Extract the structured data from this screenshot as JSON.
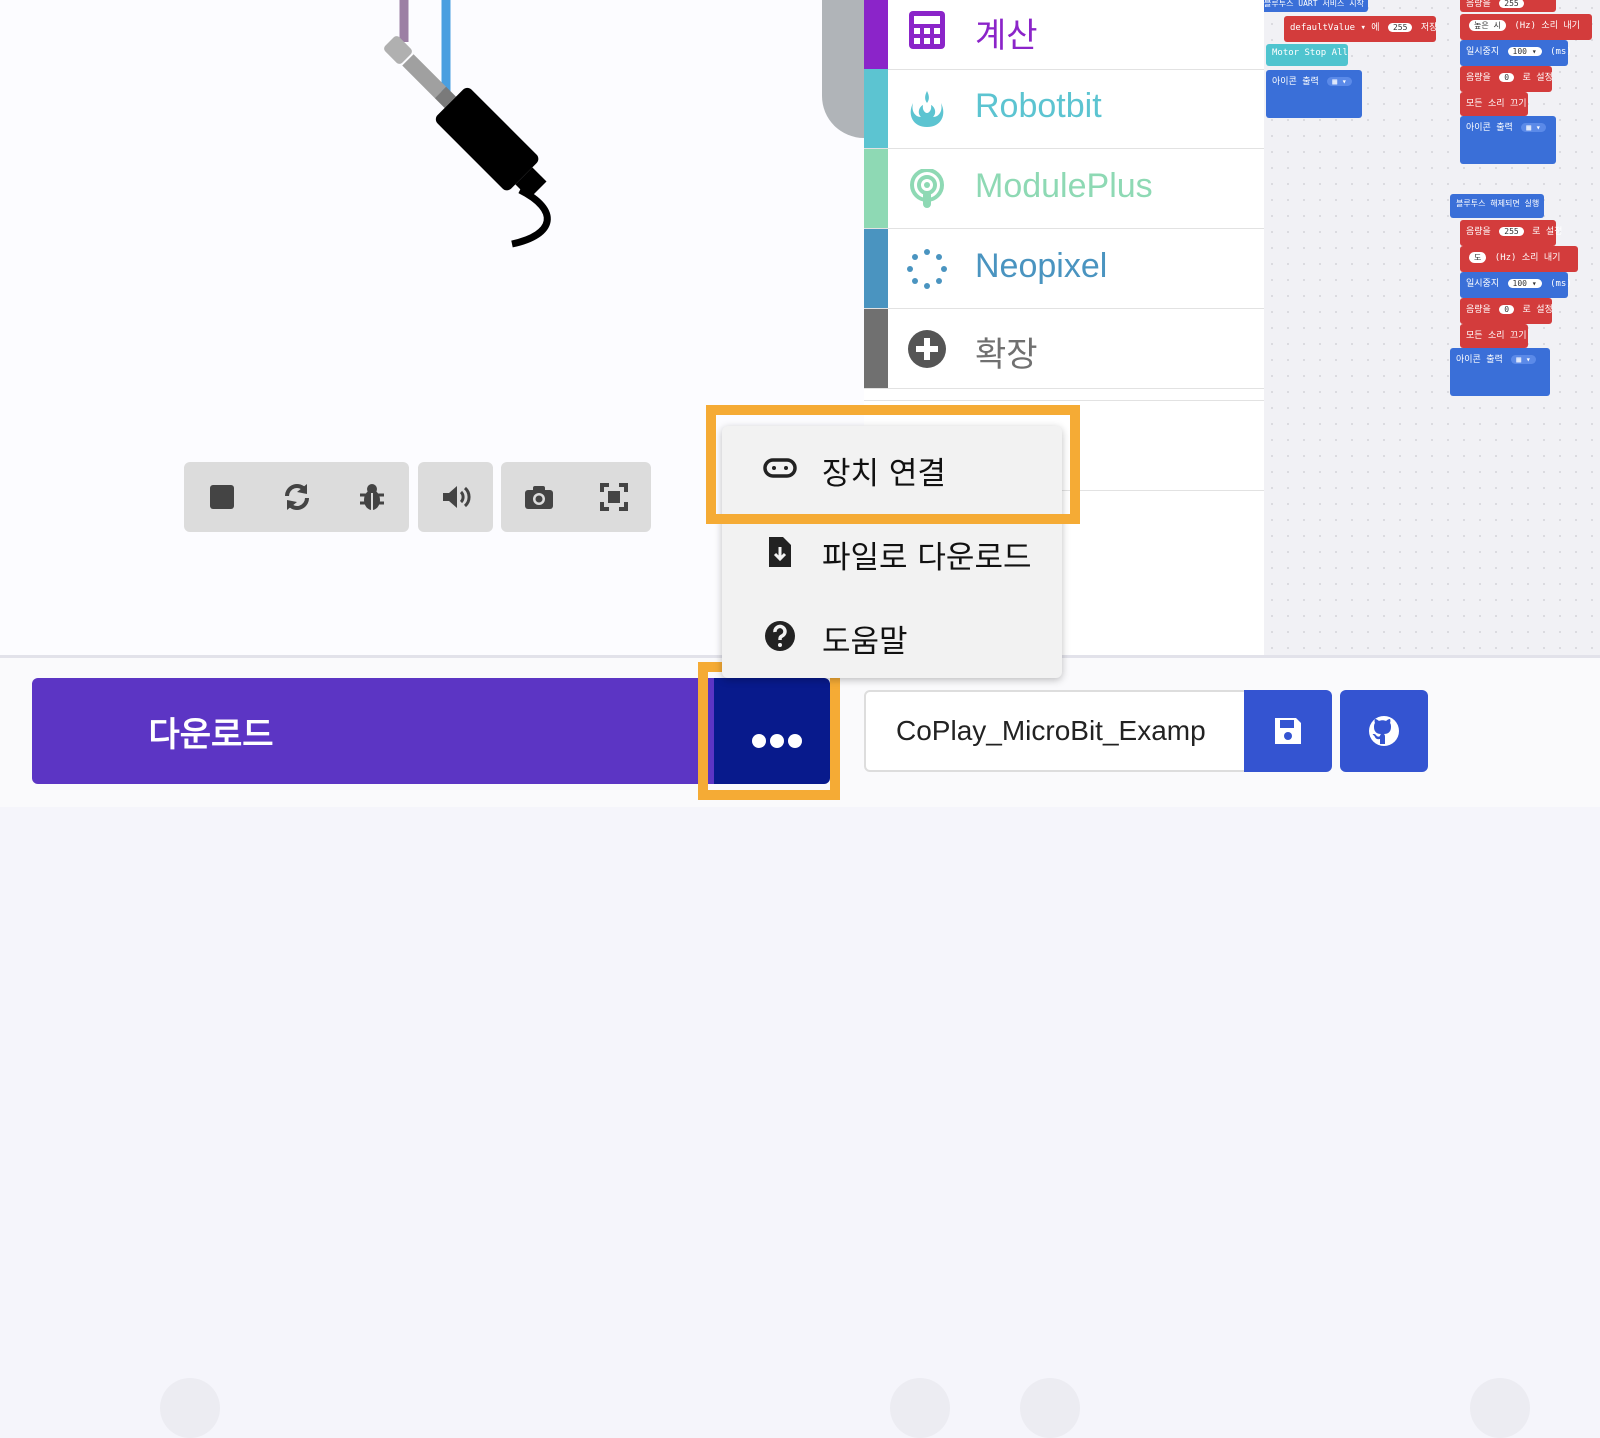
{
  "simulator": {
    "toolbar": {
      "stop": "stop-icon",
      "restart": "restart-icon",
      "debug": "bug-icon",
      "sound": "volume-icon",
      "screenshot": "camera-icon",
      "fullscreen": "fullscreen-icon"
    }
  },
  "toolbox": {
    "categories": [
      {
        "label": "계산",
        "icon": "calculator-icon",
        "color": "#8b24c9"
      },
      {
        "label": "Robotbit",
        "icon": "rebel-icon",
        "color": "#5cc4d1"
      },
      {
        "label": "ModulePlus",
        "icon": "podcast-icon",
        "color": "#8ed9b4"
      },
      {
        "label": "Neopixel",
        "icon": "circle-dots-icon",
        "color": "#4a94c0"
      },
      {
        "label": "확장",
        "icon": "plus-circle-icon",
        "color": "#707070"
      }
    ]
  },
  "workspace": {
    "blocks": {
      "uart": "블루투스 UART 서비스 시작",
      "default_value": "defaultValue ▾",
      "default_value_suffix": "에",
      "default_value_num": "255",
      "default_value_end": "저장",
      "motor_stop": "Motor Stop All",
      "icon_out": "아이콘 출력",
      "vol_set_a": "음량을",
      "vol_num_a": "255",
      "vol_set_end": "로 설정",
      "high_tone": "높은 시",
      "hz_sound": "(Hz) 소리 내기",
      "pause": "일시중지",
      "pause_num": "100 ▾",
      "ms": "(ms)",
      "vol_zero": "0",
      "stop_all": "모든 소리 끄기",
      "bt_disconnected": "블루투스 해제되면 실행",
      "do_tone": "도"
    }
  },
  "menu": {
    "items": [
      {
        "label": "장치 연결",
        "icon": "link-icon"
      },
      {
        "label": "파일로 다운로드",
        "icon": "file-download-icon"
      },
      {
        "label": "도움말",
        "icon": "question-circle-icon"
      }
    ]
  },
  "bottom": {
    "download_label": "다운로드",
    "more_icon": "ellipsis-icon",
    "project_name": "CoPlay_MicroBit_Examp",
    "save_icon": "save-icon",
    "github_icon": "github-icon"
  },
  "colors": {
    "download_bg": "#5c35c4",
    "more_bg": "#081a8c",
    "highlight": "#f5ab35",
    "save_bg": "#3454d1"
  }
}
